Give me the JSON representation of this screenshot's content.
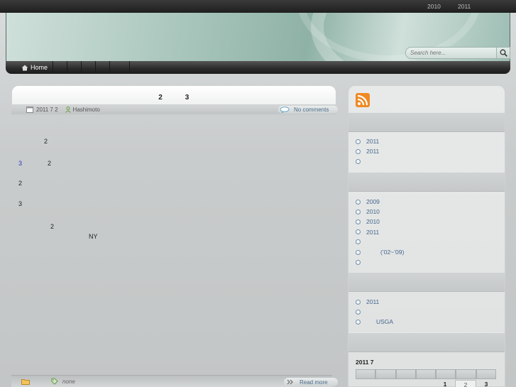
{
  "topbar": {
    "years": [
      "2010",
      "2011"
    ]
  },
  "search": {
    "placeholder": "Search here..."
  },
  "nav": {
    "home_label": "Home"
  },
  "post": {
    "title": "2　　　3",
    "date": "2011 7 2",
    "author": "Hashimoto",
    "comments_label": "No comments",
    "body_lines": [
      {
        "text": "　　　　2",
        "blue": ""
      },
      {
        "text": "　　　　2",
        "blue": "3"
      },
      {
        "text": "2",
        "blue": ""
      },
      {
        "text": "3",
        "blue": ""
      },
      {
        "text": "　　　　　2",
        "blue": ""
      },
      {
        "text": "　　　　　　　　　　　NY",
        "blue": ""
      }
    ],
    "tags_label": "none",
    "read_more_label": "Read more"
  },
  "sidebar": {
    "section1": [
      "2011",
      "2011",
      ""
    ],
    "section2": [
      "2009",
      "2010",
      "2010",
      "2011",
      "",
      "(’02~’09)",
      ""
    ],
    "section3": [
      "2011",
      "",
      "USGA"
    ],
    "calendar": {
      "title": "2011  7",
      "numbers": [
        "",
        "",
        "",
        "",
        "1",
        "2",
        "3"
      ]
    }
  },
  "colors": {
    "accent": "#44658a",
    "rss": "#f08a24"
  }
}
